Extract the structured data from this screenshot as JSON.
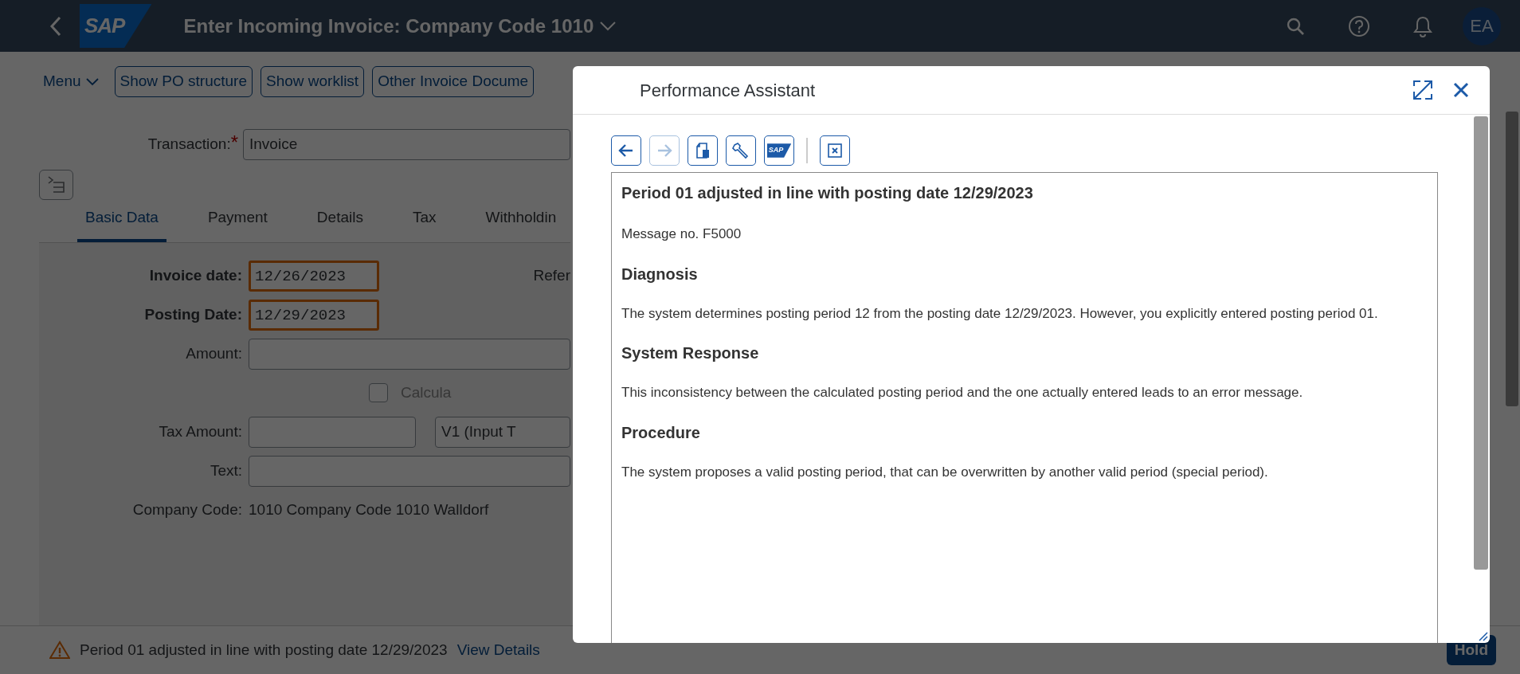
{
  "shell": {
    "logo_text": "SAP",
    "title": "Enter Incoming Invoice: Company Code 1010",
    "avatar": "EA"
  },
  "toolbar": {
    "menu": "Menu",
    "buttons": [
      "Show PO structure",
      "Show worklist",
      "Other Invoice Docume"
    ]
  },
  "transaction": {
    "label": "Transaction:",
    "required_mark": "*",
    "value": "Invoice"
  },
  "tabs": [
    {
      "label": "Basic Data",
      "selected": true
    },
    {
      "label": "Payment",
      "selected": false
    },
    {
      "label": "Details",
      "selected": false
    },
    {
      "label": "Tax",
      "selected": false
    },
    {
      "label": "Withholdin",
      "selected": false
    }
  ],
  "form": {
    "invoice_date": {
      "label": "Invoice date:",
      "value": "12/26/2023",
      "flagged": true
    },
    "posting_date": {
      "label": "Posting Date:",
      "value": "12/29/2023",
      "flagged": true
    },
    "reference_label": "Refer",
    "amount_label": "Amount:",
    "calculate": {
      "label": "Calcula",
      "checked": false
    },
    "tax_amount_label": "Tax Amount:",
    "tax_code": "V1 (Input T",
    "text_label": "Text:",
    "company_code": {
      "label": "Company Code:",
      "value": "1010 Company Code 1010 Walldorf"
    }
  },
  "footer": {
    "message": "Period 01 adjusted in line with posting date 12/29/2023",
    "link": "View Details",
    "button": "Hold"
  },
  "dialog": {
    "title": "Performance Assistant",
    "toolbar": [
      {
        "kind": "back",
        "disabled": false
      },
      {
        "kind": "forward",
        "disabled": true
      },
      {
        "kind": "document",
        "disabled": false
      },
      {
        "kind": "wrench",
        "disabled": false
      },
      {
        "kind": "sap",
        "label": "SAP",
        "disabled": false
      },
      {
        "kind": "separator"
      },
      {
        "kind": "close",
        "disabled": false
      }
    ],
    "heading": "Period 01 adjusted in line with posting date 12/29/2023",
    "message_no": "Message no. F5000",
    "sections": [
      {
        "heading": "Diagnosis",
        "text": "The system determines posting period 12 from the posting date 12/29/2023. However, you explicitly entered posting period 01."
      },
      {
        "heading": "System Response",
        "text": "This inconsistency between the calculated posting period and the one actually entered leads to an error message."
      },
      {
        "heading": "Procedure",
        "text": "The system proposes a valid posting period, that can be overwritten by another valid period (special period)."
      }
    ]
  }
}
